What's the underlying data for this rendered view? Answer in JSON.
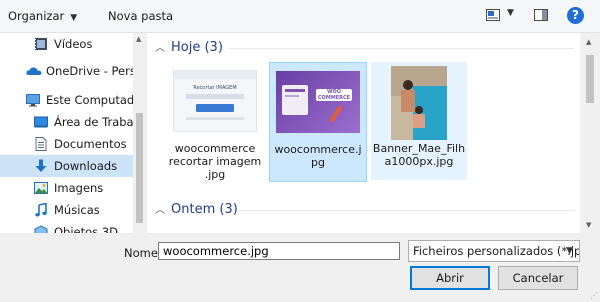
{
  "toolbar": {
    "organize_label": "Organizar",
    "new_folder_label": "Nova pasta",
    "help_label": "?",
    "icons": [
      "view-options-icon",
      "chevron-down-icon",
      "preview-pane-icon",
      "help-icon"
    ]
  },
  "nav": {
    "items": [
      {
        "label": "Vídeos",
        "icon": "videos-icon"
      },
      {
        "label": "OneDrive - Personal",
        "icon": "onedrive-icon"
      },
      {
        "label": "Este Computador",
        "icon": "computer-icon"
      },
      {
        "label": "Área de Trabalho",
        "icon": "desktop-icon"
      },
      {
        "label": "Documentos",
        "icon": "documents-icon"
      },
      {
        "label": "Downloads",
        "icon": "downloads-icon",
        "selected": true
      },
      {
        "label": "Imagens",
        "icon": "pictures-icon"
      },
      {
        "label": "Músicas",
        "icon": "music-icon"
      },
      {
        "label": "Objetos 3D",
        "icon": "objects-3d-icon"
      }
    ]
  },
  "groups": [
    {
      "header": "Hoje (3)",
      "expanded": true
    },
    {
      "header": "Ontem (3)",
      "expanded": true
    }
  ],
  "files": [
    {
      "name": "woocommerce recortar imagem .jpg",
      "state": "normal",
      "thumb_text": "Recortar IMAGEM"
    },
    {
      "name": "woocommerce.j pg",
      "state": "selected",
      "thumb_text": "WOO COMMERCE"
    },
    {
      "name": "Banner_Mae_Filh a1000px.jpg",
      "state": "hover"
    }
  ],
  "footer": {
    "name_label": "Nome:",
    "file_name_value": "woocommerce.jpg",
    "filter_value": "Ficheiros personalizados (*.jpg;",
    "open_label": "Abrir",
    "cancel_label": "Cancelar"
  },
  "colors": {
    "accent": "#0078d7",
    "selection_bg": "#cce8ff",
    "group_header": "#1e3c8c",
    "woo_purple": "#7f54b3"
  }
}
